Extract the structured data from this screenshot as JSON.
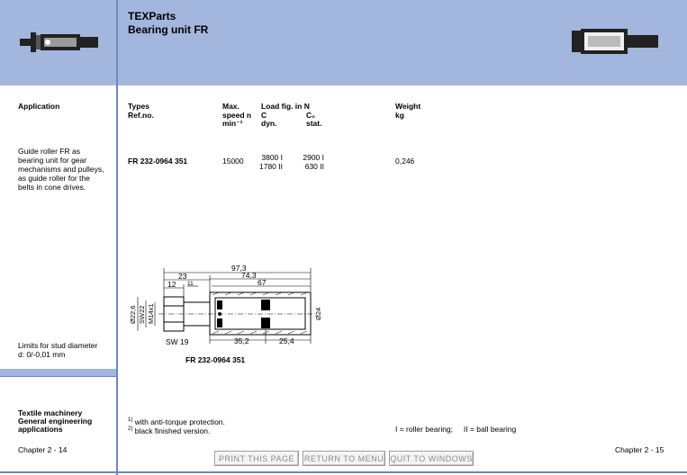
{
  "header": {
    "title": "TEXParts",
    "subtitle": "Bearing unit FR"
  },
  "left": {
    "application_label": "Application",
    "description": [
      "Guide roller FR as",
      "bearing unit for gear",
      "mechanisms and pulleys,",
      "as guide roller for the",
      "belts in cone drives."
    ],
    "limits": [
      "Limits for stud diameter",
      "d: 0/-0,01 mm"
    ],
    "sector": [
      "Textile machinery",
      "General engineering",
      "applications"
    ],
    "chapter_left": "Chapter 2 - 14"
  },
  "table": {
    "headers": {
      "types": [
        "Types",
        "Ref.no."
      ],
      "speed": [
        "Max.",
        "speed n",
        "min⁻¹"
      ],
      "load_title": "Load fig. in N",
      "load_c": [
        "C",
        "dyn."
      ],
      "load_c0": [
        "C₀",
        "stat."
      ],
      "weight": [
        "Weight",
        "kg"
      ]
    },
    "row": {
      "ref": "FR 232-0964 351",
      "speed": "15000",
      "c_dyn": [
        "3800 I",
        "1780 II"
      ],
      "c0_stat": [
        "2900 I",
        "630 II"
      ],
      "weight": "0,246"
    }
  },
  "drawing": {
    "dims": {
      "d973": "97,3",
      "d743": "74,3",
      "d67": "67",
      "d23": "23",
      "d12": "12",
      "d11": "11",
      "d226": "Ø22,6",
      "sw22": "SW22",
      "m14": "M14x1",
      "d24": "Ø24",
      "sw19": "SW 19",
      "d352": "35,2",
      "d254": "25,4"
    },
    "caption": "FR 232-0964 351"
  },
  "footnotes": {
    "f1": "with anti-torque protection.",
    "f1_mark": "1)",
    "f2": "black finished version.",
    "f2_mark": "2)",
    "legend": "I = roller bearing;     II = ball bearing"
  },
  "footer": {
    "chapter_right": "Chapter 2 - 15",
    "print": "PRINT THIS PAGE",
    "menu": "RETURN TO MENU",
    "quit": "QUIT TO WINDOWS"
  }
}
